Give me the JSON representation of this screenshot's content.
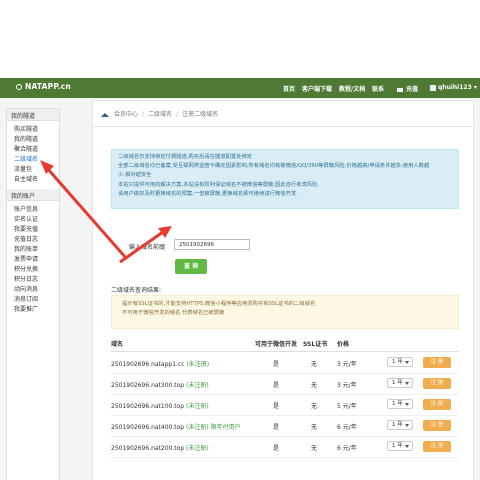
{
  "nav": {
    "brand": "NATAPP.cn",
    "items": [
      "首页",
      "客户端下载",
      "教程/文档",
      "联系"
    ],
    "charge": "充值",
    "user": "qhuihi123"
  },
  "sidebar": {
    "section1_title": "我的隧道",
    "section1_items": [
      "购买隧道",
      "我的隧道",
      "聚合隧道",
      "二级域名",
      "流量包",
      "自主域名"
    ],
    "section2_title": "我的账户",
    "section2_items": [
      "账户信息",
      "实名认证",
      "我要充值",
      "充值日志",
      "我的账单",
      "发票申请",
      "积分兑换",
      "积分日志",
      "动向消息",
      "消息订阅",
      "我要推广"
    ]
  },
  "breadcrumb": [
    "会员中心",
    "二级域名",
    "注册二级域名"
  ],
  "info_box": {
    "lines": [
      "二级域名仅支持绑定付费隧道,购买后请在隧道配置处绑定",
      "全部二级域名均已备案,受互联网类监管不确定因素影响,所有域名均有被微信/QQ/360等屏蔽风险,价格越高/申请条件越多,使用人数越",
      "少,相对越安全",
      "本站只提供可用的解决方案,本站没有权利保证域名不被微信等屏蔽,因此自行考虑风险.",
      "请用户做好及时更换域名的预案,一但被屏蔽,更换域名即可继续进行微信开发."
    ]
  },
  "form": {
    "label": "输入域名前缀",
    "value": "2501902696",
    "button": "查 询"
  },
  "results": {
    "title": "二级域名查询结果:",
    "warnings": [
      "提示有SSL证书的,才能支持HTTPS,微信小程序等应用须购买有SSL证书的二级域名",
      "不可用于微信开发的域名,代表域名已被屏蔽"
    ]
  },
  "table": {
    "headers": [
      "域名",
      "可用于微信开发",
      "SSL证书",
      "价格"
    ],
    "rows": [
      {
        "domain": "2501902696.natapp1.cc",
        "status": "(未注册)",
        "wechat": "是",
        "ssl": "无",
        "price": "3 元/年",
        "term": "1 年",
        "action": "注 册"
      },
      {
        "domain": "2501902696.nat300.top",
        "status": "(未注册)",
        "wechat": "是",
        "ssl": "无",
        "price": "3 元/年",
        "term": "1 年",
        "action": "注 册"
      },
      {
        "domain": "2501902696.nat100.top",
        "status": "(未注册)",
        "wechat": "是",
        "ssl": "无",
        "price": "5 元/年",
        "term": "1 年",
        "action": "注 册"
      },
      {
        "domain": "2501902696.nat400.top",
        "status": "(未注册) 限年付用户",
        "wechat": "是",
        "ssl": "无",
        "price": "6 元/年",
        "term": "1 年",
        "action": "注 册"
      },
      {
        "domain": "2501902696.nat200.top",
        "status": "(未注册)",
        "wechat": "是",
        "ssl": "无",
        "price": "6 元/年",
        "term": "1 年",
        "action": "注 册"
      }
    ]
  },
  "colors": {
    "navbar": "#4e7a33",
    "accent_green": "#62b845",
    "orange": "#f0ad4e",
    "arrow": "#e8392f",
    "link_blue": "#1a73c9"
  }
}
